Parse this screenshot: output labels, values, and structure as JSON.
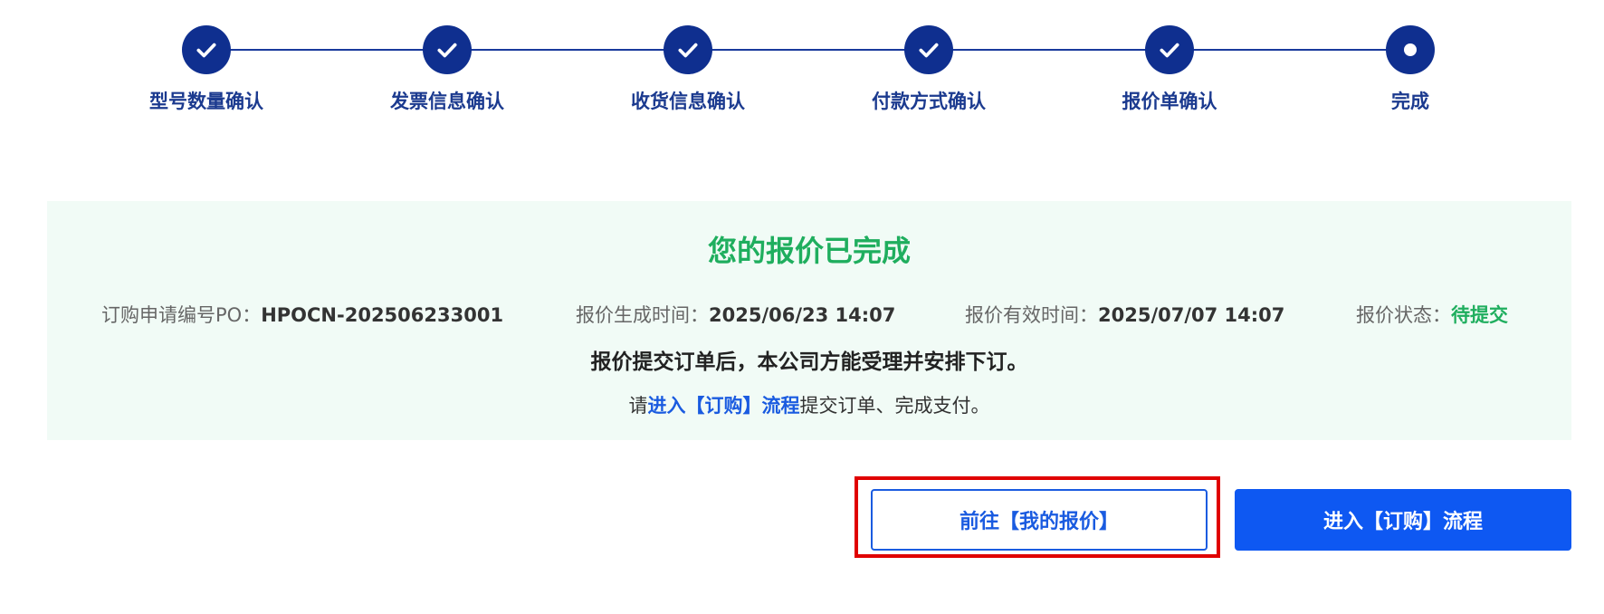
{
  "steps": [
    {
      "label": "型号数量确认",
      "state": "done"
    },
    {
      "label": "发票信息确认",
      "state": "done"
    },
    {
      "label": "收货信息确认",
      "state": "done"
    },
    {
      "label": "付款方式确认",
      "state": "done"
    },
    {
      "label": "报价单确认",
      "state": "done"
    },
    {
      "label": "完成",
      "state": "current"
    }
  ],
  "result": {
    "title": "您的报价已完成",
    "po_label": "订购申请编号PO：",
    "po_value": "HPOCN-202506233001",
    "generated_label": "报价生成时间：",
    "generated_value": "2025/06/23 14:07",
    "valid_label": "报价有效时间：",
    "valid_value": "2025/07/07 14:07",
    "status_label": "报价状态：",
    "status_value": "待提交",
    "notice": "报价提交订单后，本公司方能受理并安排下订。",
    "instruction_prefix": "请",
    "instruction_link": "进入【订购】流程",
    "instruction_suffix": "提交订单、完成支付。"
  },
  "buttons": {
    "my_quotes": "前往【我的报价】",
    "enter_order": "进入【订购】流程"
  },
  "colors": {
    "step_primary": "#0f2f8f",
    "success_green": "#1fae5e",
    "link_blue": "#1a5be0",
    "primary_button": "#0e58f2",
    "highlight_red": "#e00000",
    "panel_background": "#f1fbf6"
  },
  "icons": {
    "done_step": "check-icon",
    "current_step": "dot-icon"
  }
}
